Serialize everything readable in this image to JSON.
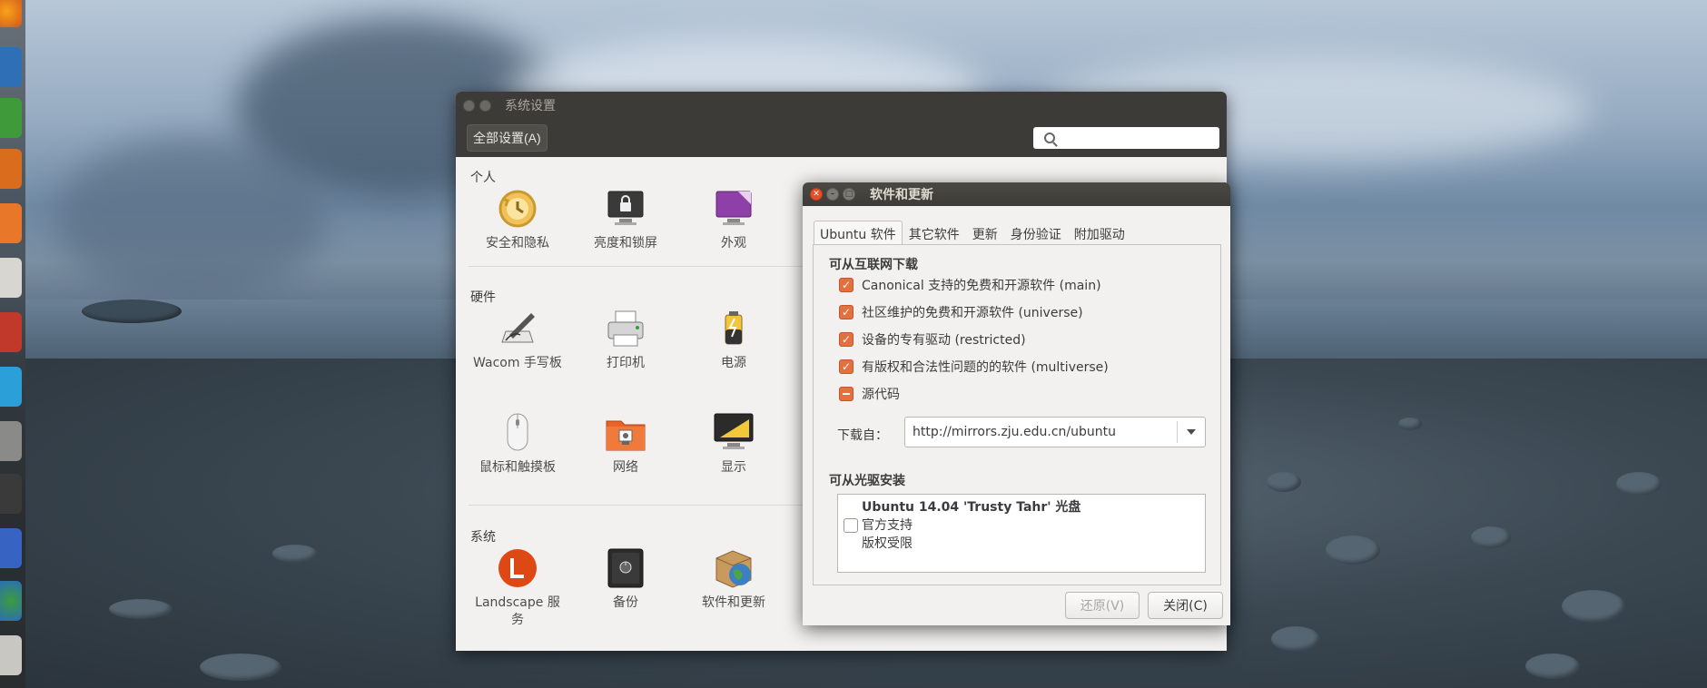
{
  "settings_window": {
    "title": "系统设置",
    "all_settings_label": "全部设置(A)",
    "sections": [
      {
        "title": "个人",
        "items": [
          "安全和隐私",
          "亮度和锁屏",
          "外观"
        ]
      },
      {
        "title": "硬件",
        "items": [
          "Wacom 手写板",
          "打印机",
          "电源",
          "鼠标和触摸板",
          "网络",
          "显示"
        ]
      },
      {
        "title": "系统",
        "items": [
          "Landscape 服务",
          "备份",
          "软件和更新"
        ]
      }
    ]
  },
  "software_dialog": {
    "title": "软件和更新",
    "tabs": [
      "Ubuntu 软件",
      "其它软件",
      "更新",
      "身份验证",
      "附加驱动"
    ],
    "active_tab": "Ubuntu 软件",
    "internet_heading": "可从互联网下载",
    "components": [
      {
        "label": "Canonical 支持的免费和开源软件 (main)",
        "state": "checked"
      },
      {
        "label": "社区维护的免费和开源软件 (universe)",
        "state": "checked"
      },
      {
        "label": "设备的专有驱动 (restricted)",
        "state": "checked"
      },
      {
        "label": "有版权和合法性问题的的软件 (multiverse)",
        "state": "checked"
      },
      {
        "label": "源代码",
        "state": "mixed"
      }
    ],
    "download_from_label": "下载自：",
    "download_server": "http://mirrors.zju.edu.cn/ubuntu",
    "cdrom_heading": "可从光驱安装",
    "cdrom_entry": {
      "title": "Ubuntu 14.04 'Trusty Tahr' 光盘",
      "line1": "官方支持",
      "line2": "版权受限",
      "state": "unchecked"
    },
    "revert_label": "还原(V)",
    "close_label": "关闭(C)"
  },
  "colors": {
    "accent": "#e3703f",
    "titlebar": "#3c3b37",
    "window_bg": "#f2f1f0"
  }
}
